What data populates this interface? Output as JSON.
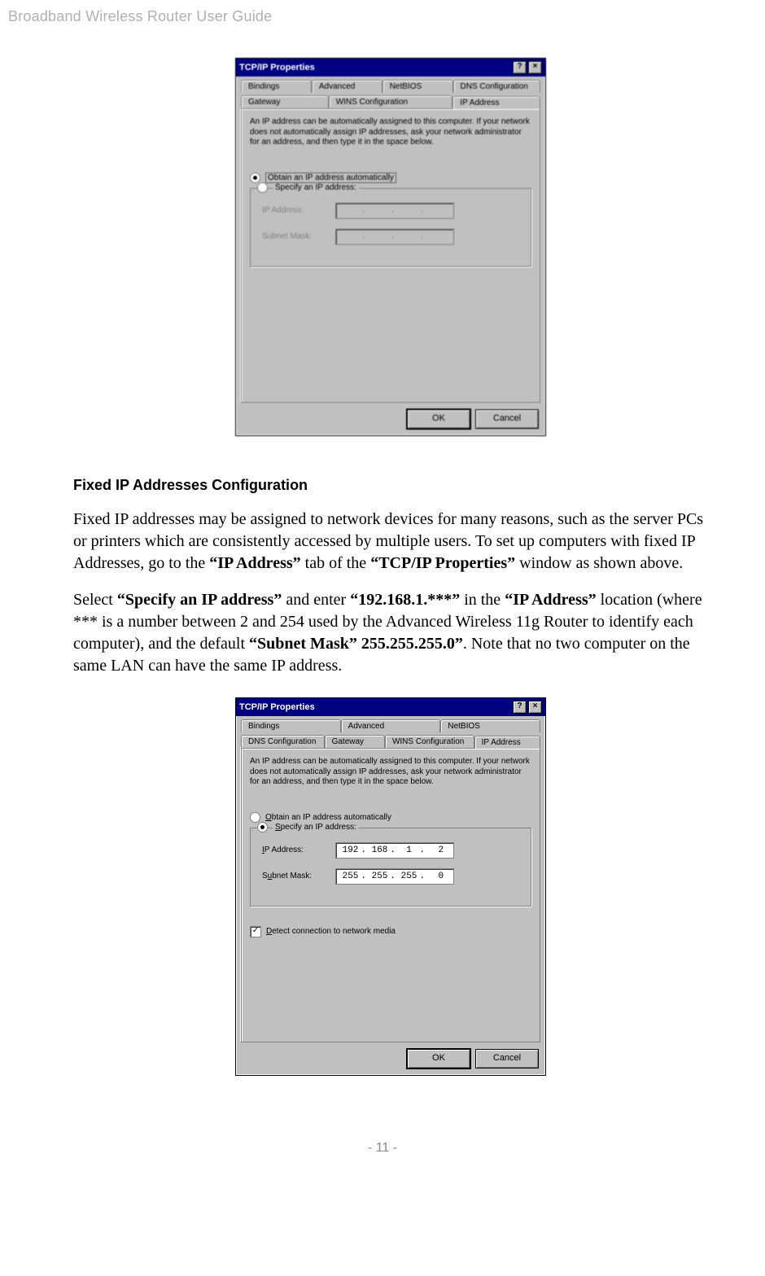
{
  "header": {
    "title": "Broadband Wireless Router User Guide"
  },
  "footer": {
    "page": "- 11 -"
  },
  "dialog1": {
    "title": "TCP/IP Properties",
    "help_btn": "?",
    "close_btn": "×",
    "tabs_row1": {
      "bindings": "Bindings",
      "advanced": "Advanced",
      "netbios": "NetBIOS",
      "dns": "DNS Configuration"
    },
    "tabs_row2": {
      "gateway": "Gateway",
      "wins": "WINS Configuration",
      "ipaddr": "IP Address"
    },
    "helptext": "An IP address can be automatically assigned to this computer. If your network does not automatically assign IP addresses, ask your network administrator for an address, and then type it in the space below.",
    "radio_obtain": "Obtain an IP address automatically",
    "radio_specify": "Specify an IP address:",
    "lbl_ip": "IP Address:",
    "lbl_subnet": "Subnet Mask:",
    "ok": "OK",
    "cancel": "Cancel"
  },
  "section": {
    "heading": "Fixed IP Addresses Configuration",
    "p1_a": "Fixed IP addresses may be assigned to network devices for many reasons, such as the server PCs or printers which are consistently accessed by multiple users. To set up computers with fixed IP Addresses, go to the ",
    "p1_b1": "“IP Address”",
    "p1_c": " tab of the ",
    "p1_b2": "“TCP/IP Properties”",
    "p1_d": " window as shown above.",
    "p2_a": "Select ",
    "p2_b1": "“Specify an IP address”",
    "p2_c": " and enter ",
    "p2_b2": "“192.168.1.***”",
    "p2_d": " in the ",
    "p2_b3": "“IP Address”",
    "p2_e": " location (where *** is a number between 2 and 254 used by the Advanced Wireless 11g Router to identify each computer), and the default ",
    "p2_b4": "“Subnet Mask” 255.255.255.0”",
    "p2_f": ". Note that no two computer on the same LAN can have the same IP address."
  },
  "dialog2": {
    "title": "TCP/IP Properties",
    "help_btn": "?",
    "close_btn": "×",
    "tabs_row1": {
      "bindings": "Bindings",
      "advanced": "Advanced",
      "netbios": "NetBIOS"
    },
    "tabs_row2": {
      "dns": "DNS Configuration",
      "gateway": "Gateway",
      "wins": "WINS Configuration",
      "ipaddr": "IP Address"
    },
    "helptext": "An IP address can be automatically assigned to this computer. If your network does not automatically assign IP addresses, ask your network administrator for an address, and then type it in the space below.",
    "radio_obtain": "Obtain an IP address automatically",
    "radio_specify": "Specify an IP address:",
    "lbl_ip": "IP Address:",
    "lbl_subnet": "Subnet Mask:",
    "ip": {
      "o1": "192",
      "o2": "168",
      "o3": "1",
      "o4": "2"
    },
    "subnet": {
      "o1": "255",
      "o2": "255",
      "o3": "255",
      "o4": "0"
    },
    "detect": "Detect connection to network media",
    "check_mark": "✓",
    "ok": "OK",
    "cancel": "Cancel"
  }
}
